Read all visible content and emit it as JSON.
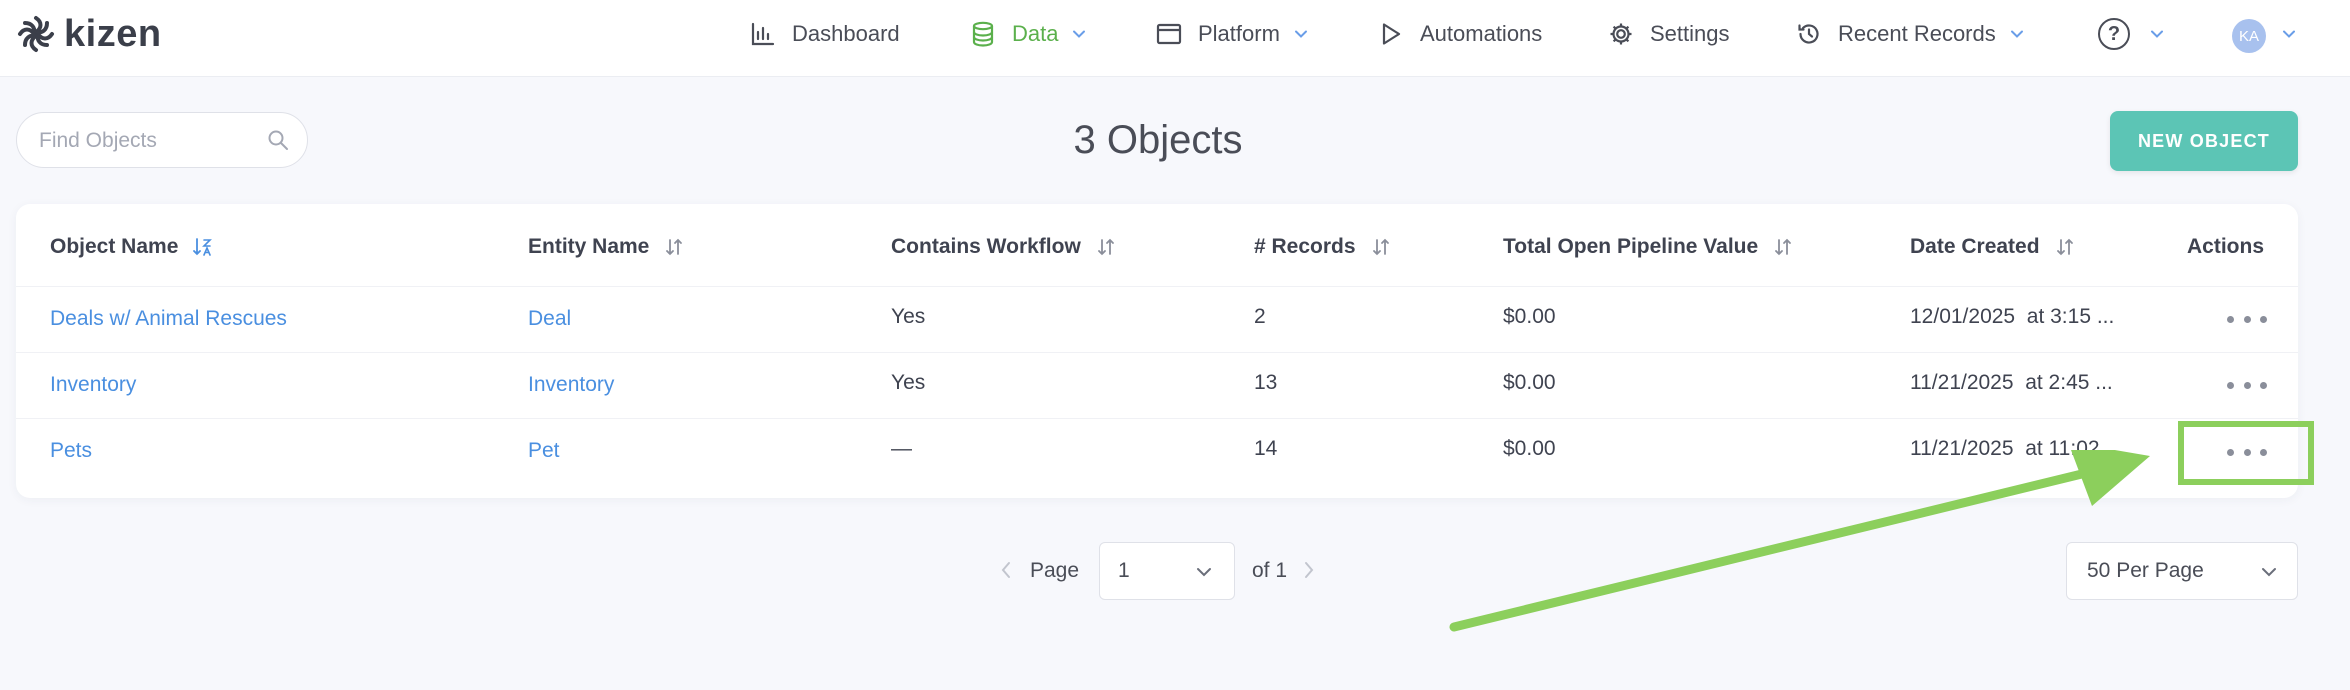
{
  "brand": {
    "name": "kizen"
  },
  "nav": {
    "dashboard": "Dashboard",
    "data": "Data",
    "platform": "Platform",
    "automations": "Automations",
    "settings": "Settings",
    "recent_records": "Recent Records",
    "help": "?",
    "avatar_initials": "KA"
  },
  "search": {
    "placeholder": "Find Objects"
  },
  "page": {
    "title": "3 Objects",
    "new_button": "NEW OBJECT"
  },
  "table": {
    "columns": [
      "Object Name",
      "Entity Name",
      "Contains Workflow",
      "# Records",
      "Total Open Pipeline Value",
      "Date Created",
      "Actions"
    ],
    "rows": [
      {
        "object_name": "Deals w/ Animal Rescues",
        "entity_name": "Deal",
        "contains_workflow": "Yes",
        "records": "2",
        "pipeline_value": "$0.00",
        "date_created": "12/01/2025  at 3:15 ..."
      },
      {
        "object_name": "Inventory",
        "entity_name": "Inventory",
        "contains_workflow": "Yes",
        "records": "13",
        "pipeline_value": "$0.00",
        "date_created": "11/21/2025  at 2:45 ..."
      },
      {
        "object_name": "Pets",
        "entity_name": "Pet",
        "contains_workflow": "—",
        "records": "14",
        "pipeline_value": "$0.00",
        "date_created": "11/21/2025  at 11:02..."
      }
    ]
  },
  "pagination": {
    "page_label": "Page",
    "current_page": "1",
    "of_label": "of 1",
    "per_page": "50 Per Page"
  },
  "colors": {
    "accent_green": "#5bb04c",
    "link_blue": "#4a8fe0",
    "button_teal": "#5cc5b5",
    "annotation_green": "#8ccf5c"
  },
  "icons": {
    "logo": "kizen-logo-icon",
    "dashboard": "bar-chart-icon",
    "data": "database-icon",
    "platform": "window-icon",
    "automations": "play-icon",
    "settings": "gear-icon",
    "recent_records": "history-icon",
    "search": "search-icon",
    "actions": "more-horizontal-icon"
  }
}
